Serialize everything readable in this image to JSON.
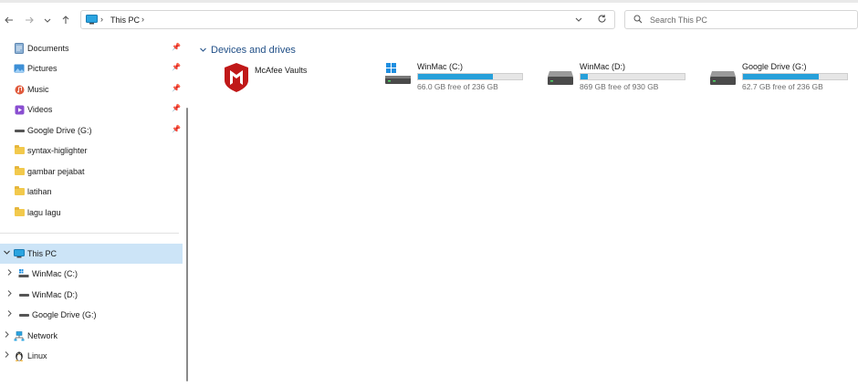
{
  "address": {
    "location": "This PC",
    "sep1": "›",
    "sep2": "›"
  },
  "search": {
    "placeholder": "Search This PC"
  },
  "nav": {
    "quick_access": [
      {
        "label": "Documents",
        "icon": "documents-icon",
        "pinned": true
      },
      {
        "label": "Pictures",
        "icon": "pictures-icon",
        "pinned": true
      },
      {
        "label": "Music",
        "icon": "music-icon",
        "pinned": true
      },
      {
        "label": "Videos",
        "icon": "videos-icon",
        "pinned": true
      },
      {
        "label": "Google Drive (G:)",
        "icon": "drive-icon",
        "pinned": true
      },
      {
        "label": "syntax-higlighter",
        "icon": "folder-icon",
        "pinned": false
      },
      {
        "label": "gambar pejabat",
        "icon": "folder-icon",
        "pinned": false
      },
      {
        "label": "latihan",
        "icon": "folder-icon",
        "pinned": false
      },
      {
        "label": "lagu lagu",
        "icon": "folder-icon",
        "pinned": false
      }
    ],
    "this_pc": {
      "label": "This PC",
      "selected": true
    },
    "this_pc_children": [
      {
        "label": "WinMac (C:)",
        "icon": "windows-drive-icon"
      },
      {
        "label": "WinMac (D:)",
        "icon": "drive-icon"
      },
      {
        "label": "Google Drive (G:)",
        "icon": "drive-icon"
      }
    ],
    "network": {
      "label": "Network"
    },
    "linux": {
      "label": "Linux"
    }
  },
  "content": {
    "group_title": "Devices and drives",
    "mcafee": {
      "title": "McAfee Vaults"
    },
    "drives": [
      {
        "title": "WinMac (C:)",
        "free_text": "66.0 GB free of 236 GB",
        "used_fraction": 0.72
      },
      {
        "title": "WinMac (D:)",
        "free_text": "869 GB free of 930 GB",
        "used_fraction": 0.066
      },
      {
        "title": "Google Drive (G:)",
        "free_text": "62.7 GB free of 236 GB",
        "used_fraction": 0.73
      }
    ]
  },
  "colors": {
    "accent": "#26a0da",
    "selection": "#cce4f7",
    "group_header": "#1f4e86",
    "mcafee_red": "#c01818"
  }
}
